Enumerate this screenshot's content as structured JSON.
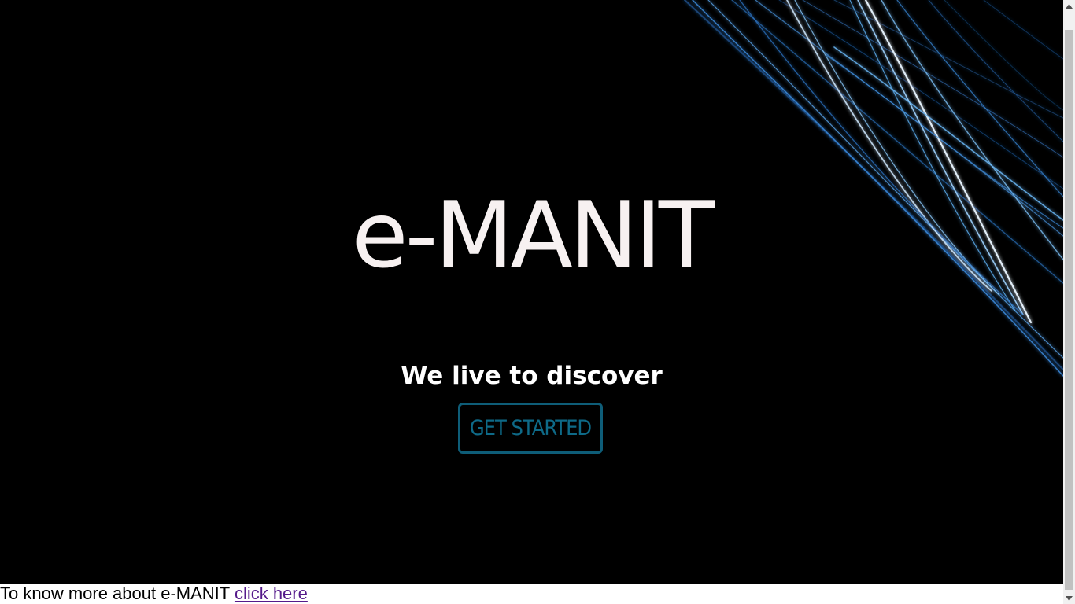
{
  "hero": {
    "title": "e-MANIT",
    "tagline": "We live to discover",
    "cta_label": "GET STARTED",
    "background_color": "#000000",
    "accent_color": "#0e6a88",
    "decoration": "blue-light-streaks"
  },
  "footer": {
    "text": "To know more about e-MANIT ",
    "link_label": "click here",
    "link_color": "#551a8b"
  },
  "scrollbar": {
    "up_icon": "triangle-up-icon",
    "down_icon": "triangle-down-icon"
  }
}
